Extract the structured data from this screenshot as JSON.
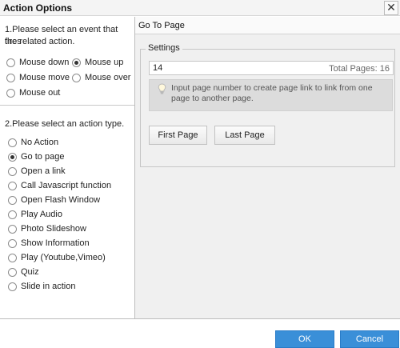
{
  "window": {
    "title": "Action Options",
    "close_glyph": "✕"
  },
  "event_section": {
    "prompt_line1": "1.Please select an event that fires",
    "prompt_line2": "the related action.",
    "options": [
      {
        "label": "Mouse down",
        "checked": false
      },
      {
        "label": "Mouse up",
        "checked": true
      },
      {
        "label": "Mouse move",
        "checked": false
      },
      {
        "label": "Mouse over",
        "checked": false
      },
      {
        "label": "Mouse out",
        "checked": false
      }
    ]
  },
  "action_section": {
    "prompt": "2.Please select an action type.",
    "options": [
      {
        "label": "No Action",
        "checked": false
      },
      {
        "label": "Go to page",
        "checked": true
      },
      {
        "label": "Open a link",
        "checked": false
      },
      {
        "label": "Call Javascript function",
        "checked": false
      },
      {
        "label": "Open Flash Window",
        "checked": false
      },
      {
        "label": "Play Audio",
        "checked": false
      },
      {
        "label": "Photo Slideshow",
        "checked": false
      },
      {
        "label": "Show Information",
        "checked": false
      },
      {
        "label": "Play (Youtube,Vimeo)",
        "checked": false
      },
      {
        "label": "Quiz",
        "checked": false
      },
      {
        "label": "Slide in action",
        "checked": false
      }
    ]
  },
  "panel": {
    "header": "Go To Page",
    "settings_legend": "Settings",
    "page_value": "14",
    "total_pages": "Total Pages: 16",
    "hint_icon": "lightbulb-icon",
    "hint": "Input page number to create page link to link from one page to another page.",
    "first_page_label": "First Page",
    "last_page_label": "Last Page"
  },
  "footer": {
    "ok_label": "OK",
    "cancel_label": "Cancel"
  },
  "colors": {
    "accent": "#3a8fd8",
    "panel_bg": "#f0f0f0",
    "hint_bg": "#dcdcdc"
  }
}
